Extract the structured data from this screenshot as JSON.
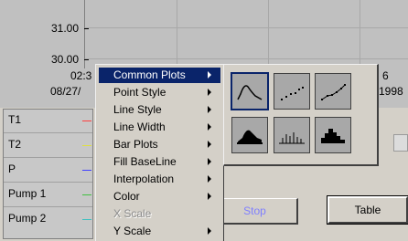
{
  "graph": {
    "y_labels": [
      "31.00",
      "30.00"
    ],
    "x_labels": {
      "time_left": "02:3",
      "date_left": "08/27/",
      "time_right": "6",
      "date_right": "1998"
    }
  },
  "legend": {
    "items": [
      {
        "name": "T1",
        "color": "#ff4040"
      },
      {
        "name": "T2",
        "color": "#e0e040"
      },
      {
        "name": "P",
        "color": "#4040ff"
      },
      {
        "name": "Pump 1",
        "color": "#40c040"
      },
      {
        "name": "Pump 2",
        "color": "#40c0c0"
      }
    ]
  },
  "buttons": {
    "stop": "Stop",
    "table": "Table"
  },
  "context_menu": {
    "items": [
      {
        "label": "Common Plots",
        "has_submenu": true,
        "active": true,
        "disabled": false
      },
      {
        "label": "Point Style",
        "has_submenu": true,
        "active": false,
        "disabled": false
      },
      {
        "label": "Line Style",
        "has_submenu": true,
        "active": false,
        "disabled": false
      },
      {
        "label": "Line Width",
        "has_submenu": true,
        "active": false,
        "disabled": false
      },
      {
        "label": "Bar Plots",
        "has_submenu": true,
        "active": false,
        "disabled": false
      },
      {
        "label": "Fill BaseLine",
        "has_submenu": true,
        "active": false,
        "disabled": false
      },
      {
        "label": "Interpolation",
        "has_submenu": true,
        "active": false,
        "disabled": false
      },
      {
        "label": "Color",
        "has_submenu": true,
        "active": false,
        "disabled": false
      },
      {
        "label": "X Scale",
        "has_submenu": false,
        "active": false,
        "disabled": true
      },
      {
        "label": "Y Scale",
        "has_submenu": true,
        "active": false,
        "disabled": false
      }
    ]
  },
  "submenu": {
    "icons": [
      "line-plot-icon",
      "scatter-plot-icon",
      "line-with-points-plot-icon",
      "filled-area-plot-icon",
      "bar-plot-icon",
      "filled-step-plot-icon"
    ],
    "selected_index": 0
  }
}
